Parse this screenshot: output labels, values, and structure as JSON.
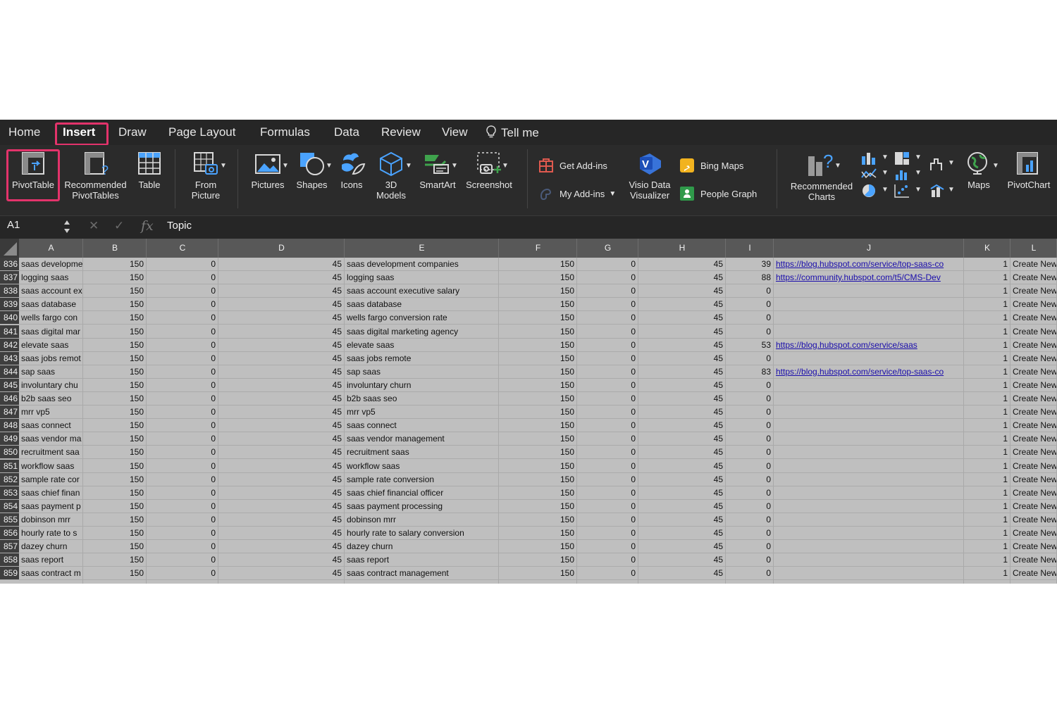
{
  "menu": {
    "tabs": [
      {
        "label": "Home",
        "active": false
      },
      {
        "label": "Insert",
        "active": true
      },
      {
        "label": "Draw",
        "active": false
      },
      {
        "label": "Page Layout",
        "active": false
      },
      {
        "label": "Formulas",
        "active": false
      },
      {
        "label": "Data",
        "active": false
      },
      {
        "label": "Review",
        "active": false
      },
      {
        "label": "View",
        "active": false
      }
    ],
    "tell_me": "Tell me"
  },
  "ribbon": {
    "pivottable": "PivotTable",
    "recommended_pivot_1": "Recommended",
    "recommended_pivot_2": "PivotTables",
    "table": "Table",
    "from_picture_1": "From",
    "from_picture_2": "Picture",
    "pictures": "Pictures",
    "shapes": "Shapes",
    "icons": "Icons",
    "models_1": "3D",
    "models_2": "Models",
    "smartart": "SmartArt",
    "screenshot": "Screenshot",
    "get_addins": "Get Add-ins",
    "my_addins": "My Add-ins",
    "visio_1": "Visio Data",
    "visio_2": "Visualizer",
    "bing_maps": "Bing Maps",
    "people_graph": "People Graph",
    "recommended_charts_1": "Recommended",
    "recommended_charts_2": "Charts",
    "maps": "Maps",
    "pivotchart": "PivotChart"
  },
  "formula_bar": {
    "name_box": "A1",
    "cancel_glyph": "✕",
    "enter_glyph": "✓",
    "fx": "fx",
    "value": "Topic"
  },
  "grid": {
    "columns": [
      "A",
      "B",
      "C",
      "D",
      "E",
      "F",
      "G",
      "H",
      "I",
      "J",
      "K",
      "L"
    ],
    "rows": [
      {
        "n": "836",
        "a": "saas developme",
        "b": "150",
        "c": "0",
        "d": "45",
        "e": "saas development companies",
        "f": "150",
        "g": "0",
        "h": "45",
        "i": "39",
        "j": "https://blog.hubspot.com/service/top-saas-co",
        "k": "1",
        "l": "Create New"
      },
      {
        "n": "837",
        "a": "logging saas",
        "b": "150",
        "c": "0",
        "d": "45",
        "e": "logging saas",
        "f": "150",
        "g": "0",
        "h": "45",
        "i": "88",
        "j": "https://community.hubspot.com/t5/CMS-Dev",
        "k": "1",
        "l": "Create New"
      },
      {
        "n": "838",
        "a": "saas account ex",
        "b": "150",
        "c": "0",
        "d": "45",
        "e": "saas account executive salary",
        "f": "150",
        "g": "0",
        "h": "45",
        "i": "0",
        "j": "",
        "k": "1",
        "l": "Create New"
      },
      {
        "n": "839",
        "a": "saas database",
        "b": "150",
        "c": "0",
        "d": "45",
        "e": "saas database",
        "f": "150",
        "g": "0",
        "h": "45",
        "i": "0",
        "j": "",
        "k": "1",
        "l": "Create New"
      },
      {
        "n": "840",
        "a": "wells fargo con",
        "b": "150",
        "c": "0",
        "d": "45",
        "e": "wells fargo conversion rate",
        "f": "150",
        "g": "0",
        "h": "45",
        "i": "0",
        "j": "",
        "k": "1",
        "l": "Create New"
      },
      {
        "n": "841",
        "a": "saas digital mar",
        "b": "150",
        "c": "0",
        "d": "45",
        "e": "saas digital marketing agency",
        "f": "150",
        "g": "0",
        "h": "45",
        "i": "0",
        "j": "",
        "k": "1",
        "l": "Create New"
      },
      {
        "n": "842",
        "a": "elevate saas",
        "b": "150",
        "c": "0",
        "d": "45",
        "e": "elevate saas",
        "f": "150",
        "g": "0",
        "h": "45",
        "i": "53",
        "j": "https://blog.hubspot.com/service/saas",
        "k": "1",
        "l": "Create New"
      },
      {
        "n": "843",
        "a": "saas jobs remot",
        "b": "150",
        "c": "0",
        "d": "45",
        "e": "saas jobs remote",
        "f": "150",
        "g": "0",
        "h": "45",
        "i": "0",
        "j": "",
        "k": "1",
        "l": "Create New"
      },
      {
        "n": "844",
        "a": "sap saas",
        "b": "150",
        "c": "0",
        "d": "45",
        "e": "sap saas",
        "f": "150",
        "g": "0",
        "h": "45",
        "i": "83",
        "j": "https://blog.hubspot.com/service/top-saas-co",
        "k": "1",
        "l": "Create New"
      },
      {
        "n": "845",
        "a": "involuntary chu",
        "b": "150",
        "c": "0",
        "d": "45",
        "e": "involuntary churn",
        "f": "150",
        "g": "0",
        "h": "45",
        "i": "0",
        "j": "",
        "k": "1",
        "l": "Create New"
      },
      {
        "n": "846",
        "a": "b2b saas seo",
        "b": "150",
        "c": "0",
        "d": "45",
        "e": "b2b saas seo",
        "f": "150",
        "g": "0",
        "h": "45",
        "i": "0",
        "j": "",
        "k": "1",
        "l": "Create New"
      },
      {
        "n": "847",
        "a": "mrr vp5",
        "b": "150",
        "c": "0",
        "d": "45",
        "e": "mrr vp5",
        "f": "150",
        "g": "0",
        "h": "45",
        "i": "0",
        "j": "",
        "k": "1",
        "l": "Create New"
      },
      {
        "n": "848",
        "a": "saas connect",
        "b": "150",
        "c": "0",
        "d": "45",
        "e": "saas connect",
        "f": "150",
        "g": "0",
        "h": "45",
        "i": "0",
        "j": "",
        "k": "1",
        "l": "Create New"
      },
      {
        "n": "849",
        "a": "saas vendor ma",
        "b": "150",
        "c": "0",
        "d": "45",
        "e": "saas vendor management",
        "f": "150",
        "g": "0",
        "h": "45",
        "i": "0",
        "j": "",
        "k": "1",
        "l": "Create New"
      },
      {
        "n": "850",
        "a": "recruitment saa",
        "b": "150",
        "c": "0",
        "d": "45",
        "e": "recruitment saas",
        "f": "150",
        "g": "0",
        "h": "45",
        "i": "0",
        "j": "",
        "k": "1",
        "l": "Create New"
      },
      {
        "n": "851",
        "a": "workflow saas",
        "b": "150",
        "c": "0",
        "d": "45",
        "e": "workflow saas",
        "f": "150",
        "g": "0",
        "h": "45",
        "i": "0",
        "j": "",
        "k": "1",
        "l": "Create New"
      },
      {
        "n": "852",
        "a": "sample rate cor",
        "b": "150",
        "c": "0",
        "d": "45",
        "e": "sample rate conversion",
        "f": "150",
        "g": "0",
        "h": "45",
        "i": "0",
        "j": "",
        "k": "1",
        "l": "Create New"
      },
      {
        "n": "853",
        "a": "saas chief finan",
        "b": "150",
        "c": "0",
        "d": "45",
        "e": "saas chief financial officer",
        "f": "150",
        "g": "0",
        "h": "45",
        "i": "0",
        "j": "",
        "k": "1",
        "l": "Create New"
      },
      {
        "n": "854",
        "a": "saas payment p",
        "b": "150",
        "c": "0",
        "d": "45",
        "e": "saas payment processing",
        "f": "150",
        "g": "0",
        "h": "45",
        "i": "0",
        "j": "",
        "k": "1",
        "l": "Create New"
      },
      {
        "n": "855",
        "a": "dobinson mrr",
        "b": "150",
        "c": "0",
        "d": "45",
        "e": "dobinson mrr",
        "f": "150",
        "g": "0",
        "h": "45",
        "i": "0",
        "j": "",
        "k": "1",
        "l": "Create New"
      },
      {
        "n": "856",
        "a": "hourly rate to s",
        "b": "150",
        "c": "0",
        "d": "45",
        "e": "hourly rate to salary conversion",
        "f": "150",
        "g": "0",
        "h": "45",
        "i": "0",
        "j": "",
        "k": "1",
        "l": "Create New"
      },
      {
        "n": "857",
        "a": "dazey churn",
        "b": "150",
        "c": "0",
        "d": "45",
        "e": "dazey churn",
        "f": "150",
        "g": "0",
        "h": "45",
        "i": "0",
        "j": "",
        "k": "1",
        "l": "Create New"
      },
      {
        "n": "858",
        "a": "saas report",
        "b": "150",
        "c": "0",
        "d": "45",
        "e": "saas report",
        "f": "150",
        "g": "0",
        "h": "45",
        "i": "0",
        "j": "",
        "k": "1",
        "l": "Create New"
      },
      {
        "n": "859",
        "a": "saas contract m",
        "b": "150",
        "c": "0",
        "d": "45",
        "e": "saas contract management",
        "f": "150",
        "g": "0",
        "h": "45",
        "i": "0",
        "j": "",
        "k": "1",
        "l": "Create New"
      }
    ]
  },
  "colors": {
    "accent_highlight": "#e3336b",
    "ribbon_bg": "#2b2b2b",
    "grid_bg": "#bfbfbf",
    "link": "#1a0dab"
  }
}
